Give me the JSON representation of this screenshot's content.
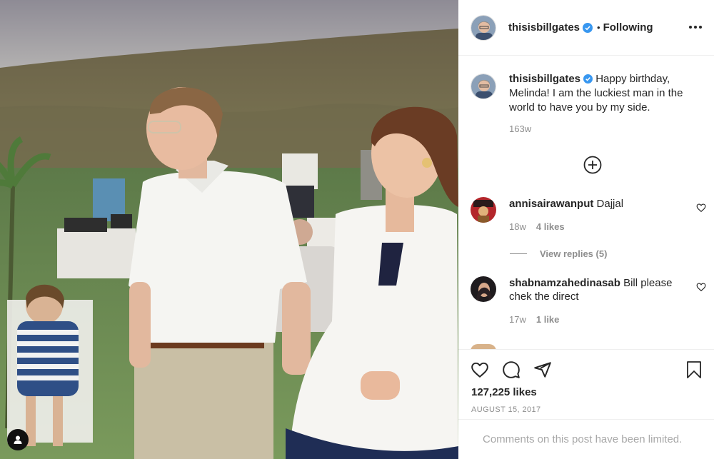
{
  "post": {
    "author": {
      "username": "thisisbillgates",
      "verified": true,
      "follow_status": "Following",
      "separator": "•"
    },
    "caption": {
      "text": "Happy birthday, Melinda! I am the luckiest man in the world to have you by my side.",
      "timestamp": "163w"
    },
    "comments": [
      {
        "username": "annisairawanput",
        "text": "Dajjal",
        "age": "18w",
        "likes": "4 likes",
        "view_replies": "View replies (5)"
      },
      {
        "username": "shabnamzahedinasab",
        "text": "Bill please chek the direct",
        "age": "17w",
        "likes": "1 like"
      }
    ],
    "likes_count": "127,225 likes",
    "date": "August 15, 2017",
    "comments_notice": "Comments on this post have been limited."
  },
  "icons": {
    "more": "more-options-icon",
    "load_more": "plus-circle-icon",
    "like": "heart-icon",
    "comment": "comment-bubble-icon",
    "share": "paper-plane-icon",
    "save": "bookmark-icon",
    "verified": "verified-badge-icon",
    "user_tag": "user-tag-icon"
  },
  "colors": {
    "verified_blue": "#3897f0",
    "secondary_text": "#8e8e8e",
    "primary_text": "#262626"
  }
}
